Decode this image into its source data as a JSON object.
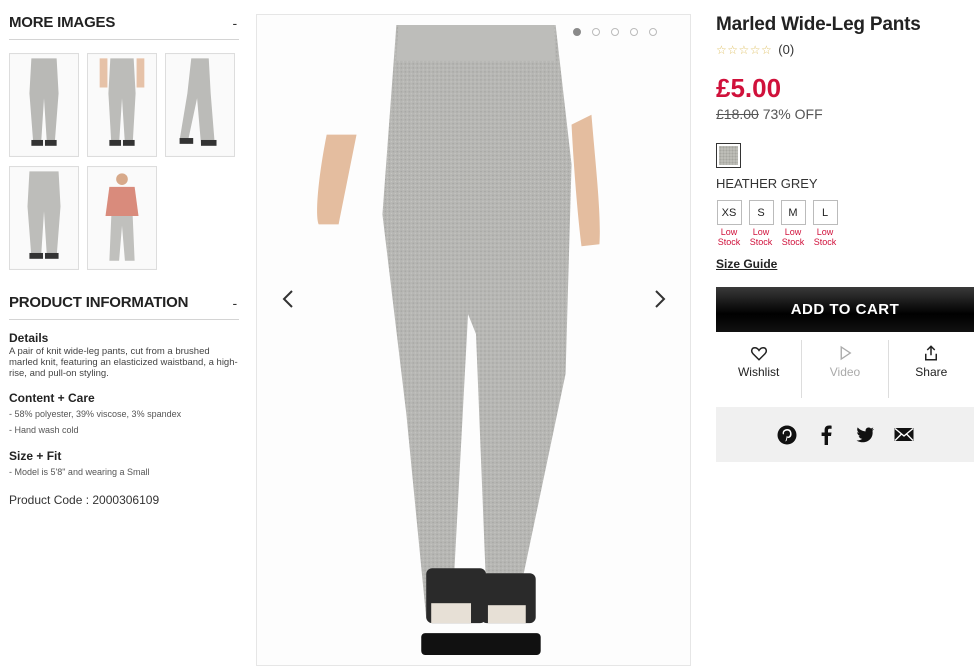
{
  "more_images": {
    "heading": "MORE IMAGES",
    "toggle": "-",
    "thumbnails": [
      "pants-front",
      "pants-front-alt",
      "pants-side",
      "pants-detail",
      "full-outfit"
    ]
  },
  "product_information": {
    "heading": "PRODUCT INFORMATION",
    "toggle": "-",
    "details_title": "Details",
    "details_text": "A pair of knit wide-leg pants, cut from a brushed marled knit, featuring an elasticized waistband, a high-rise, and pull-on styling.",
    "content_title": "Content + Care",
    "content_items": [
      "- 58% polyester, 39% viscose, 3% spandex",
      "- Hand wash cold"
    ],
    "size_title": "Size + Fit",
    "size_items": [
      "- Model is 5'8\" and wearing a Small"
    ],
    "product_code": "Product Code : 2000306109"
  },
  "gallery": {
    "dot_count": 5,
    "active_dot": 0,
    "prev_icon": "chevron-left-icon",
    "next_icon": "chevron-right-icon"
  },
  "product": {
    "title": "Marled Wide-Leg Pants",
    "stars": "☆☆☆☆☆",
    "review_count": "(0)",
    "price": "£5.00",
    "original_price": "£18.00",
    "discount": "73% OFF",
    "color_name": "HEATHER GREY",
    "sizes": [
      {
        "label": "XS",
        "stock": "Low Stock"
      },
      {
        "label": "S",
        "stock": "Low Stock"
      },
      {
        "label": "M",
        "stock": "Low Stock"
      },
      {
        "label": "L",
        "stock": "Low Stock"
      }
    ],
    "size_guide": "Size Guide",
    "add_to_cart": "ADD TO CART"
  },
  "actions": {
    "wishlist": "Wishlist",
    "video": "Video",
    "share": "Share"
  },
  "social": [
    "pinterest-icon",
    "facebook-icon",
    "twitter-icon",
    "email-icon"
  ],
  "colors": {
    "price_red": "#d0113b",
    "cart_black": "#000000",
    "social_bg": "#f0f0f0"
  }
}
